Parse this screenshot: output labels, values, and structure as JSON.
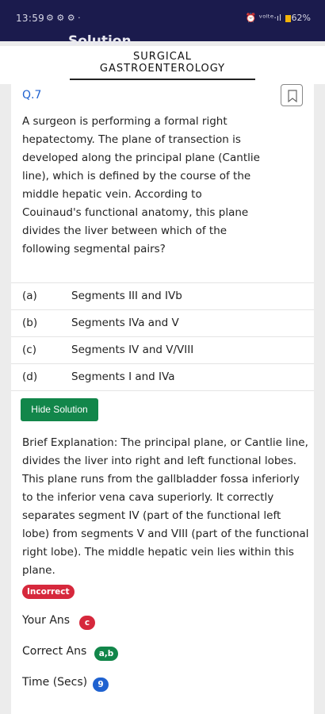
{
  "status_bar": {
    "time": "13:59",
    "indicators": "⚙ ⚙ ⚙ ·",
    "right_text": "⏰ ᵛᵒˡᵗᵉ·ıl",
    "battery": "62%"
  },
  "behind_title": "Solution",
  "header": {
    "line1": "SURGICAL",
    "line2": "GASTROENTEROLOGY"
  },
  "question": {
    "number": "Q.7",
    "text": "A surgeon is performing a formal right hepatectomy. The plane of transection is developed along the principal plane (Cantlie line), which is defined by the course of the middle hepatic vein. According to Couinaud's functional anatomy, this plane divides the liver between which of the following segmental pairs?",
    "options": [
      {
        "label": "(a)",
        "text": "Segments III and IVb"
      },
      {
        "label": "(b)",
        "text": "Segments IVa and V"
      },
      {
        "label": "(c)",
        "text": "Segments IV and V/VIII"
      },
      {
        "label": "(d)",
        "text": "Segments I and IVa"
      }
    ]
  },
  "solution": {
    "hide_button": "Hide Solution",
    "explanation": "Brief Explanation: The principal plane, or Cantlie line, divides the liver into right and left functional lobes. This plane runs from the gallbladder fossa inferiorly to the inferior vena cava superiorly. It correctly separates segment IV (part of the functional left lobe) from segments V and VIII (part of the functional right lobe). The middle hepatic vein lies within this plane.",
    "result_badge": "Incorrect"
  },
  "stats": {
    "your_ans_label": "Your Ans",
    "your_ans_value": "c",
    "correct_ans_label": "Correct Ans",
    "correct_ans_value": "a,b",
    "time_label": "Time (Secs)",
    "time_value": "9"
  },
  "colors": {
    "status_bar": "#1b1b4d",
    "accent_blue": "#1f62d0",
    "incorrect_red": "#d6283c",
    "correct_green": "#12864a"
  }
}
